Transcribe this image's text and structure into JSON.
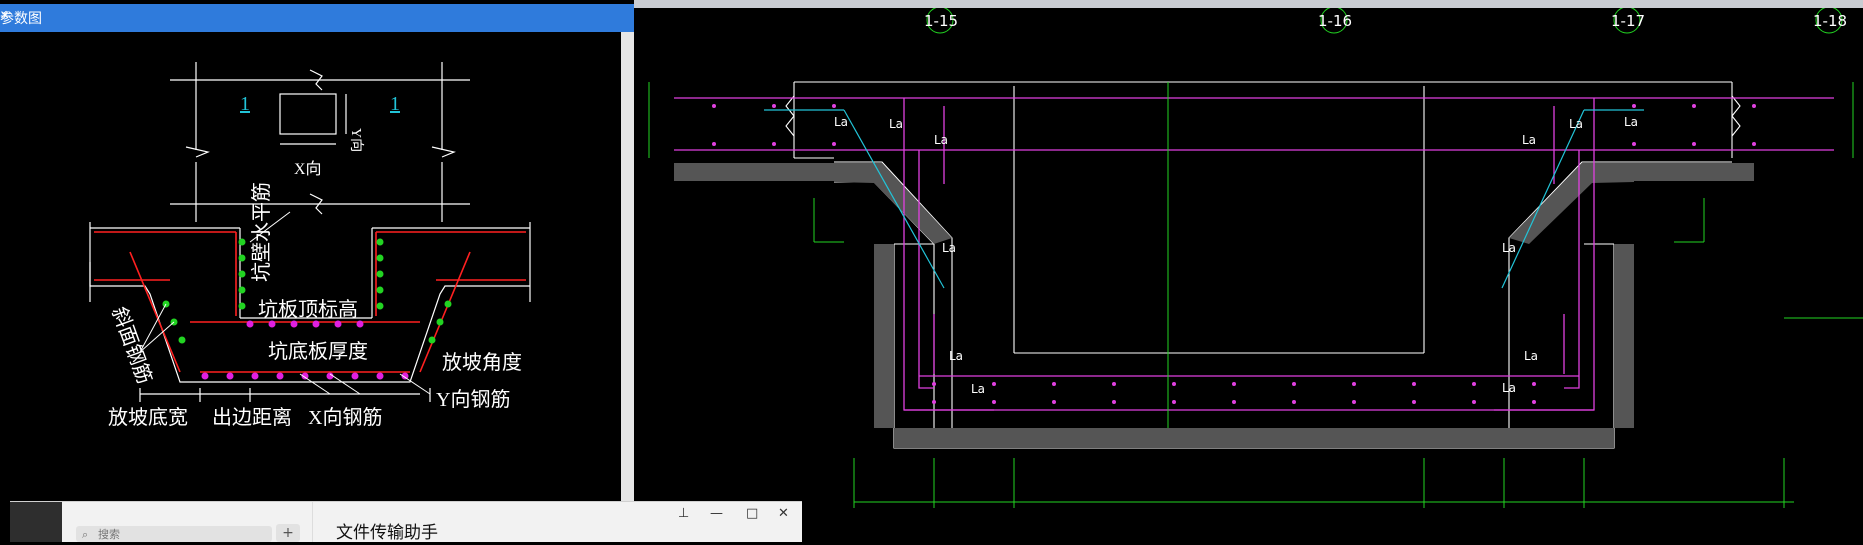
{
  "param_window": {
    "title": "参数图",
    "close_glyph": "×",
    "labels": {
      "num_left": "1",
      "num_right": "1",
      "y_dir": "Y向",
      "x_dir": "X向",
      "wall_horizontal_rebar": "坑壁水平筋",
      "slab_top_elev": "坑板顶标高",
      "slope_rebar": "斜面钢筋",
      "bottom_thickness": "坑底板厚度",
      "slope_angle": "放坡角度",
      "y_rebar": "Y向钢筋",
      "slope_bottom_width": "放坡底宽",
      "edge_distance": "出边距离",
      "x_rebar": "X向钢筋"
    }
  },
  "cad": {
    "axis_labels": [
      "1-15",
      "1-16",
      "1-17",
      "1-18"
    ],
    "la_label": "La",
    "colors": {
      "magenta": "#e040e0",
      "green": "#22d422",
      "cyan": "#22c4d8",
      "white": "#ffffff",
      "red": "#ff2020",
      "yellow": "#e8e820"
    }
  },
  "chat": {
    "search_placeholder": "搜索",
    "plus_label": "+",
    "title": "文件传输助手",
    "pin_glyph": "⊥",
    "min_glyph": "—",
    "max_glyph": "□",
    "close_glyph": "✕"
  }
}
